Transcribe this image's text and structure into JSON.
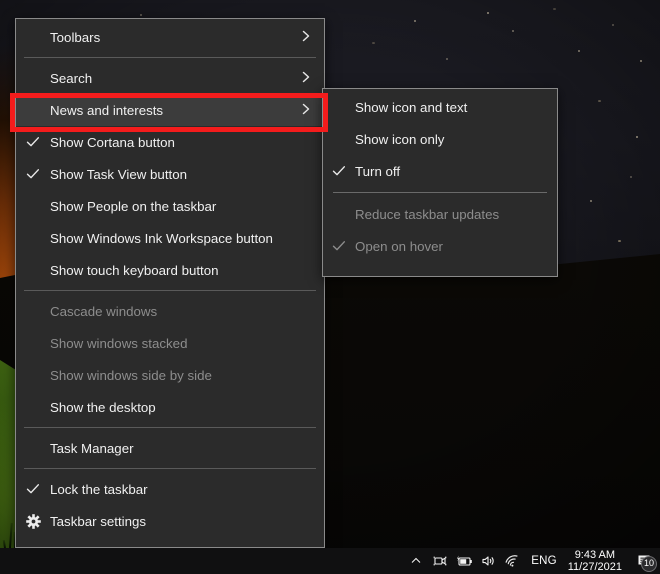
{
  "desktop": {
    "wallpaper_description": "night sky with stars over dark hills and a green-lit grassy slope",
    "colors": {
      "menu_background": "#2b2b2b",
      "menu_border": "#8a8a8a",
      "menu_text": "#f0f0f0",
      "menu_disabled_text": "#8d8d8d",
      "menu_highlight": "#3c3c3c",
      "annotation_red": "#f41c1c",
      "taskbar_background": "#101011"
    }
  },
  "context_menu": {
    "name": "taskbar-context-menu",
    "items": [
      {
        "id": "toolbars",
        "label": "Toolbars",
        "checked": false,
        "disabled": false,
        "submenu": true,
        "highlighted": false,
        "separator_after": true
      },
      {
        "id": "search",
        "label": "Search",
        "checked": false,
        "disabled": false,
        "submenu": true,
        "highlighted": false,
        "separator_after": false
      },
      {
        "id": "news-and-interests",
        "label": "News and interests",
        "checked": false,
        "disabled": false,
        "submenu": true,
        "highlighted": true,
        "separator_after": false
      },
      {
        "id": "show-cortana",
        "label": "Show Cortana button",
        "checked": true,
        "disabled": false,
        "submenu": false,
        "highlighted": false,
        "separator_after": false
      },
      {
        "id": "show-task-view",
        "label": "Show Task View button",
        "checked": true,
        "disabled": false,
        "submenu": false,
        "highlighted": false,
        "separator_after": false
      },
      {
        "id": "show-people",
        "label": "Show People on the taskbar",
        "checked": false,
        "disabled": false,
        "submenu": false,
        "highlighted": false,
        "separator_after": false
      },
      {
        "id": "show-ink-workspace",
        "label": "Show Windows Ink Workspace button",
        "checked": false,
        "disabled": false,
        "submenu": false,
        "highlighted": false,
        "separator_after": false
      },
      {
        "id": "show-touch-keyboard",
        "label": "Show touch keyboard button",
        "checked": false,
        "disabled": false,
        "submenu": false,
        "highlighted": false,
        "separator_after": true
      },
      {
        "id": "cascade-windows",
        "label": "Cascade windows",
        "checked": false,
        "disabled": true,
        "submenu": false,
        "highlighted": false,
        "separator_after": false
      },
      {
        "id": "show-windows-stacked",
        "label": "Show windows stacked",
        "checked": false,
        "disabled": true,
        "submenu": false,
        "highlighted": false,
        "separator_after": false
      },
      {
        "id": "show-windows-side",
        "label": "Show windows side by side",
        "checked": false,
        "disabled": true,
        "submenu": false,
        "highlighted": false,
        "separator_after": false
      },
      {
        "id": "show-the-desktop",
        "label": "Show the desktop",
        "checked": false,
        "disabled": false,
        "submenu": false,
        "highlighted": false,
        "separator_after": true
      },
      {
        "id": "task-manager",
        "label": "Task Manager",
        "checked": false,
        "disabled": false,
        "submenu": false,
        "highlighted": false,
        "separator_after": true
      },
      {
        "id": "lock-the-taskbar",
        "label": "Lock the taskbar",
        "checked": true,
        "disabled": false,
        "submenu": false,
        "highlighted": false,
        "separator_after": false
      },
      {
        "id": "taskbar-settings",
        "label": "Taskbar settings",
        "checked": false,
        "disabled": false,
        "submenu": false,
        "highlighted": false,
        "separator_after": false,
        "icon": "gear-icon"
      }
    ]
  },
  "submenu": {
    "name": "news-and-interests-submenu",
    "items": [
      {
        "id": "show-icon-and-text",
        "label": "Show icon and text",
        "checked": false,
        "disabled": false,
        "separator_after": false
      },
      {
        "id": "show-icon-only",
        "label": "Show icon only",
        "checked": false,
        "disabled": false,
        "separator_after": false
      },
      {
        "id": "turn-off",
        "label": "Turn off",
        "checked": true,
        "disabled": false,
        "separator_after": true
      },
      {
        "id": "reduce-taskbar-updates",
        "label": "Reduce taskbar updates",
        "checked": false,
        "disabled": true,
        "separator_after": false
      },
      {
        "id": "open-on-hover",
        "label": "Open on hover",
        "checked": true,
        "disabled": true,
        "separator_after": false
      }
    ]
  },
  "taskbar": {
    "tray_icons": [
      {
        "id": "show-hidden-icons",
        "name": "chevron-up-icon"
      },
      {
        "id": "camera-in-use",
        "name": "camera-icon"
      },
      {
        "id": "battery",
        "name": "battery-charging-icon"
      },
      {
        "id": "volume",
        "name": "speaker-icon"
      },
      {
        "id": "network",
        "name": "wifi-icon"
      }
    ],
    "language": "ENG",
    "clock": {
      "time": "9:43 AM",
      "date": "11/27/2021"
    },
    "action_center": {
      "name": "action-center-icon",
      "badge": "10"
    }
  },
  "annotation": {
    "type": "red-highlight-rectangle",
    "targets": "news-and-interests"
  }
}
